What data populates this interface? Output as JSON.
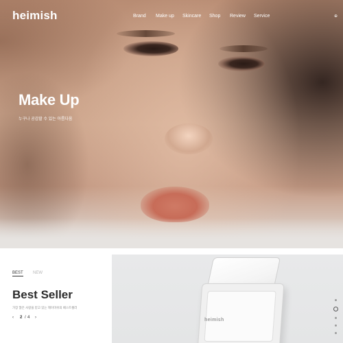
{
  "header": {
    "logo": "heimish",
    "nav": [
      "Brand",
      "Make up",
      "Skincare",
      "Shop",
      "Review",
      "Service"
    ],
    "lang_icon": "globe-icon",
    "lang_glyph": "⊕"
  },
  "hero": {
    "title": "Make Up",
    "subtitle": "누구나 공감할 수 있는 아름다움"
  },
  "best_seller": {
    "tabs": [
      "BEST",
      "NEW"
    ],
    "active_tab": "BEST",
    "title": "Best Seller",
    "description": "가장 많은 사랑을 받고 있는 헤이미쉬의 베스트셀러",
    "pager": {
      "prev": "‹",
      "current": "2",
      "separator": "/",
      "total": "4",
      "next": "›"
    }
  },
  "product": {
    "brand_text": "heimish"
  },
  "side_dots": {
    "count": 5,
    "active": 1
  },
  "colors": {
    "accent": "#2b2b2b",
    "muted": "#b5b5b5"
  }
}
